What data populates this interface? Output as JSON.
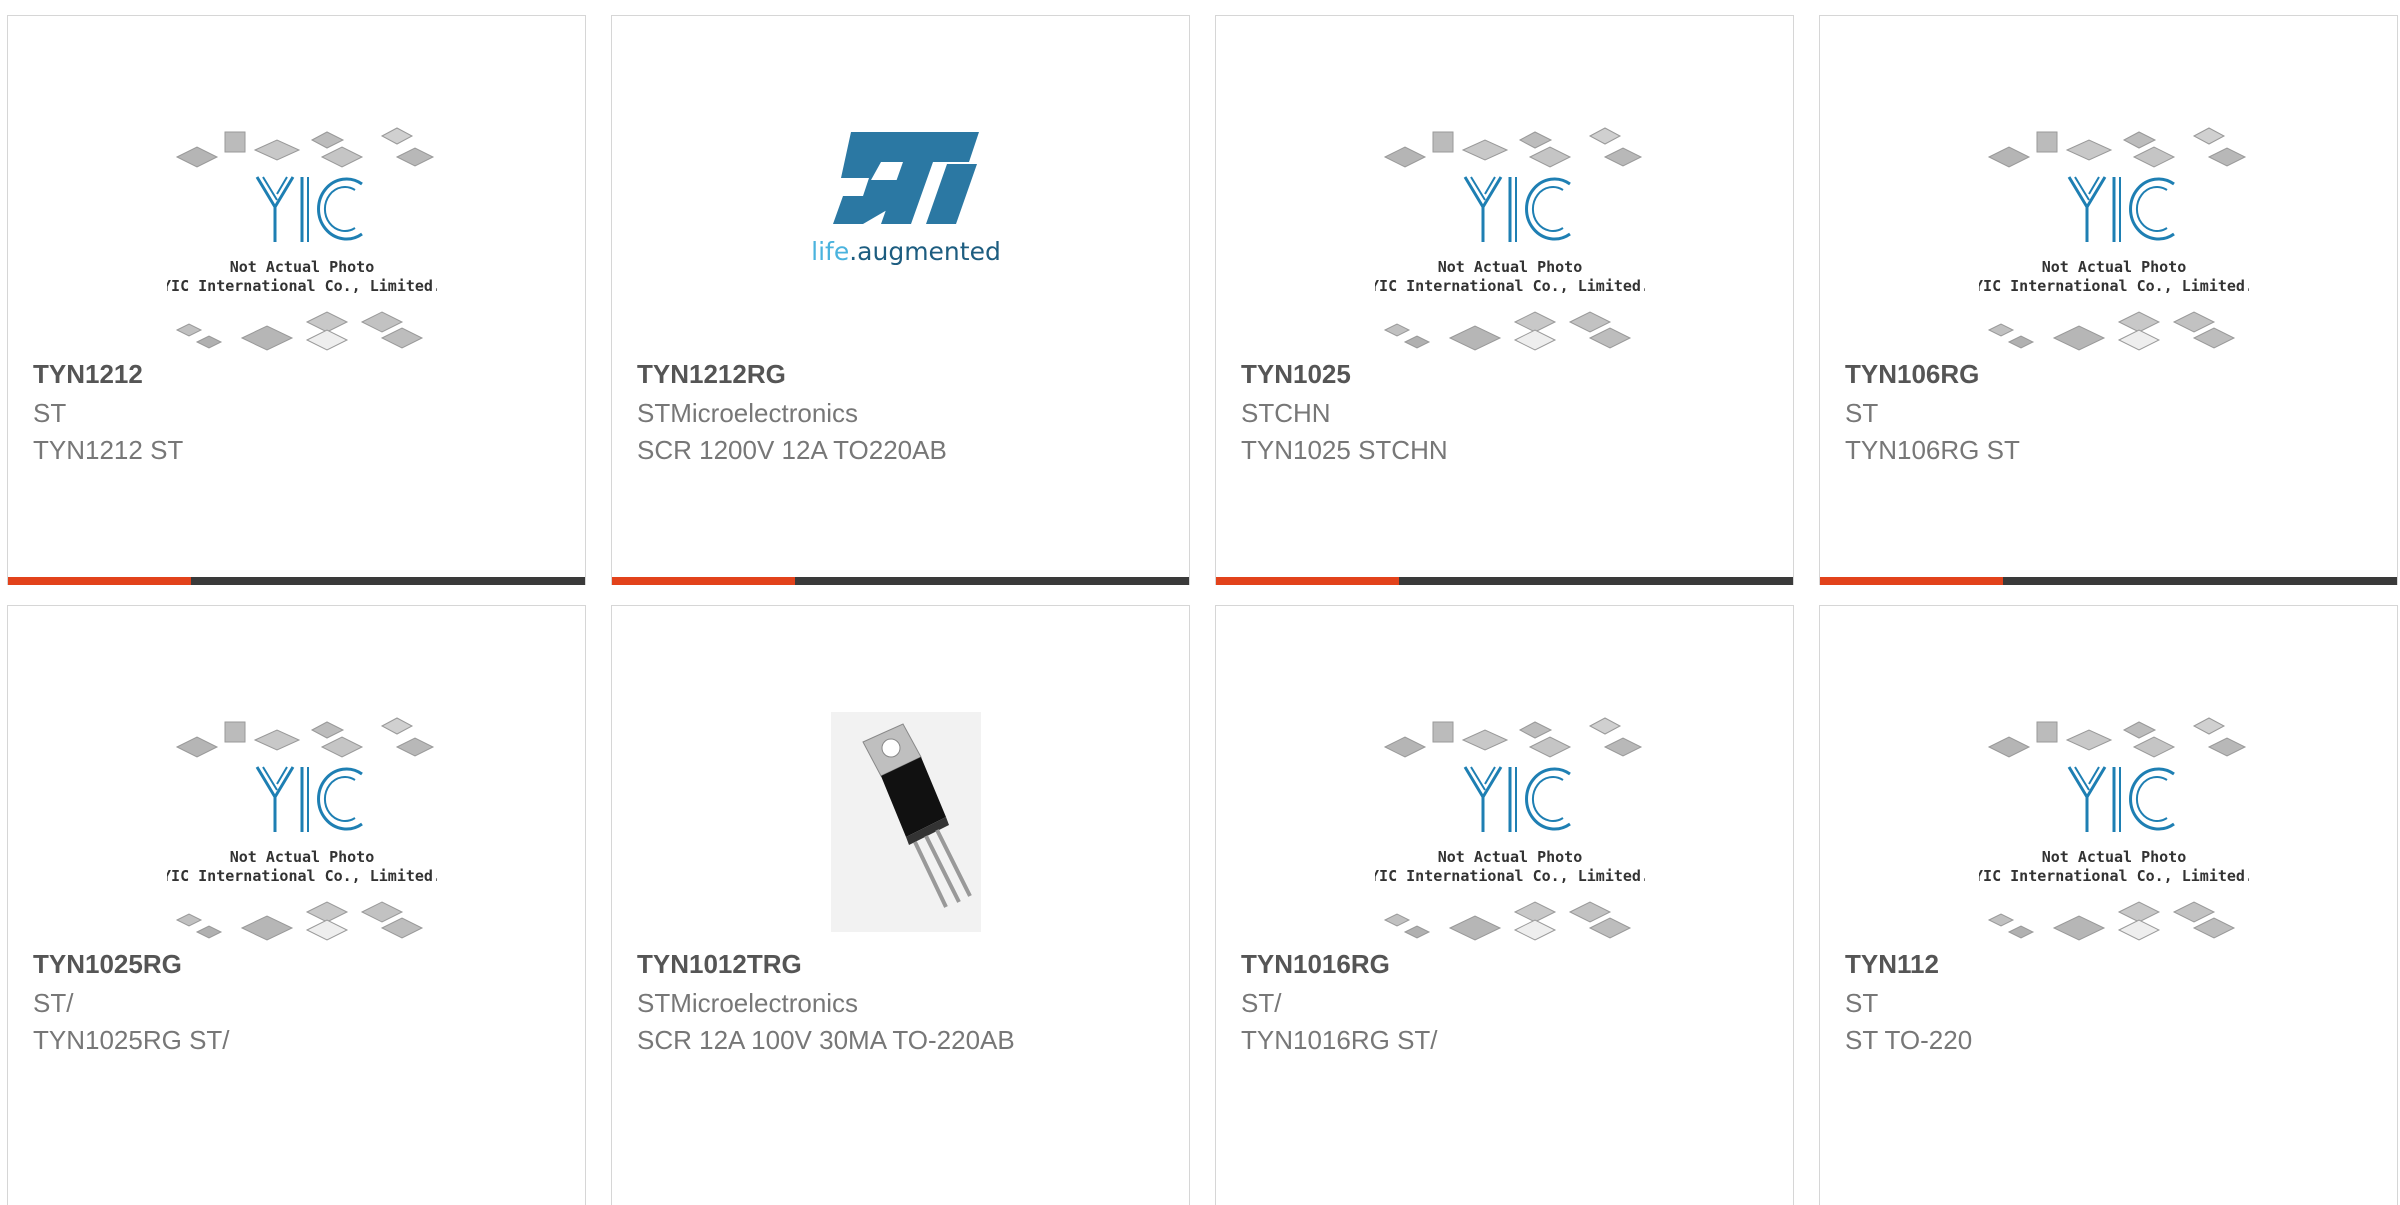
{
  "theme": {
    "accent": "#e2421b",
    "bar": "#3a3a3a",
    "logo_blue": "#1e7fb3"
  },
  "placeholder": {
    "line1": "Not Actual Photo",
    "line2": "YIC International Co., Limited."
  },
  "st_logo": {
    "tagline_a": "life",
    "tagline_b": ".augmented"
  },
  "products": [
    {
      "name": "TYN1212",
      "brand": "ST",
      "desc": "TYN1212 ST",
      "image": "yic-placeholder"
    },
    {
      "name": "TYN1212RG",
      "brand": "STMicroelectronics",
      "desc": "SCR 1200V 12A TO220AB",
      "image": "st-logo"
    },
    {
      "name": "TYN1025",
      "brand": "STCHN",
      "desc": "TYN1025 STCHN",
      "image": "yic-placeholder"
    },
    {
      "name": "TYN106RG",
      "brand": "ST",
      "desc": "TYN106RG ST",
      "image": "yic-placeholder"
    },
    {
      "name": "TYN1025RG",
      "brand": "ST/",
      "desc": "TYN1025RG ST/",
      "image": "yic-placeholder"
    },
    {
      "name": "TYN1012TRG",
      "brand": "STMicroelectronics",
      "desc": "SCR 12A 100V 30MA TO-220AB",
      "image": "to220-photo"
    },
    {
      "name": "TYN1016RG",
      "brand": "ST/",
      "desc": "TYN1016RG ST/",
      "image": "yic-placeholder"
    },
    {
      "name": "TYN112",
      "brand": "ST",
      "desc": "ST TO-220",
      "image": "yic-placeholder"
    }
  ]
}
